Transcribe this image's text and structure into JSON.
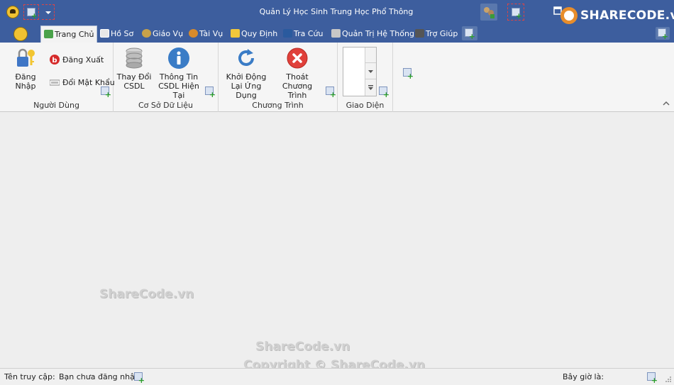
{
  "window": {
    "title": "Quản Lý Học Sinh Trung Học Phổ Thông",
    "brand": "SHARECODE.vn"
  },
  "tabs": [
    {
      "label": "Trang Chủ",
      "active": true,
      "icon": "home-icon"
    },
    {
      "label": "Hồ Sơ",
      "icon": "id-card-icon"
    },
    {
      "label": "Giáo Vụ",
      "icon": "teacher-icon"
    },
    {
      "label": "Tài Vụ",
      "icon": "user-money-icon"
    },
    {
      "label": "Quy Định",
      "icon": "rules-icon"
    },
    {
      "label": "Tra Cứu",
      "icon": "binoculars-icon"
    },
    {
      "label": "Quản Trị Hệ Thống",
      "icon": "tools-icon"
    },
    {
      "label": "Trợ Giúp",
      "icon": "help-book-icon"
    }
  ],
  "ribbon": {
    "groups": {
      "user": {
        "label": "Người Dùng",
        "login": "Đăng Nhập",
        "logout": "Đăng Xuất",
        "change_password": "Đổi Mật Khẩu"
      },
      "database": {
        "label": "Cơ Sở Dữ Liệu",
        "change_db_line1": "Thay Đổi",
        "change_db_line2": "CSDL",
        "db_info_line1": "Thông Tin",
        "db_info_line2": "CSDL Hiện Tại"
      },
      "program": {
        "label": "Chương Trình",
        "restart_line1": "Khởi Động",
        "restart_line2": "Lại Ứng Dụng",
        "exit_line1": "Thoát Chương",
        "exit_line2": "Trình"
      },
      "interface": {
        "label": "Giao Diện"
      }
    }
  },
  "watermarks": [
    "ShareCode.vn",
    "ShareCode.vn",
    "Copyright © ShareCode.vn"
  ],
  "statusbar": {
    "access_label": "Tên truy cập:",
    "access_value": "Bạn chưa đăng nhập",
    "time_label": "Bây giờ là:"
  },
  "colors": {
    "titlebar": "#3d5e9e",
    "ribbon": "#f5f5f5",
    "content": "#eeeeee"
  }
}
